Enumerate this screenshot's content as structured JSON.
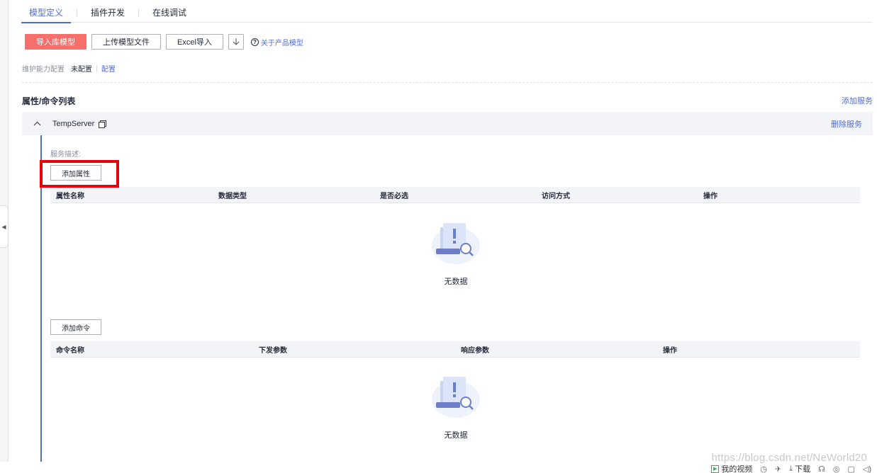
{
  "tabs": [
    {
      "label": "模型定义"
    },
    {
      "label": "插件开发"
    },
    {
      "label": "在线调试"
    }
  ],
  "toolbar": {
    "import_lib": "导入库模型",
    "upload_file": "上传模型文件",
    "excel_import": "Excel导入",
    "about_model": "关于产品模型"
  },
  "maintain": {
    "label": "维护能力配置",
    "value": "未配置",
    "link": "配置"
  },
  "section": {
    "title": "属性/命令列表",
    "add_service": "添加服务"
  },
  "service": {
    "name": "TempServer",
    "delete": "删除服务",
    "desc_label": "服务描述:"
  },
  "properties": {
    "add_button": "添加属性",
    "columns": [
      "属性名称",
      "数据类型",
      "是否必选",
      "访问方式",
      "操作"
    ],
    "empty_text": "无数据"
  },
  "commands": {
    "add_button": "添加命令",
    "columns": [
      "命令名称",
      "下发参数",
      "响应参数",
      "操作"
    ],
    "empty_text": "无数据"
  },
  "bottom_bar": {
    "watermark": "https://blog.csdn.net/NeWorld20",
    "my_video": "我的视频",
    "download": "下载"
  },
  "colors": {
    "primary_button": "#f66f6a",
    "link": "#526ecc",
    "highlight_box": "#e8000b"
  }
}
